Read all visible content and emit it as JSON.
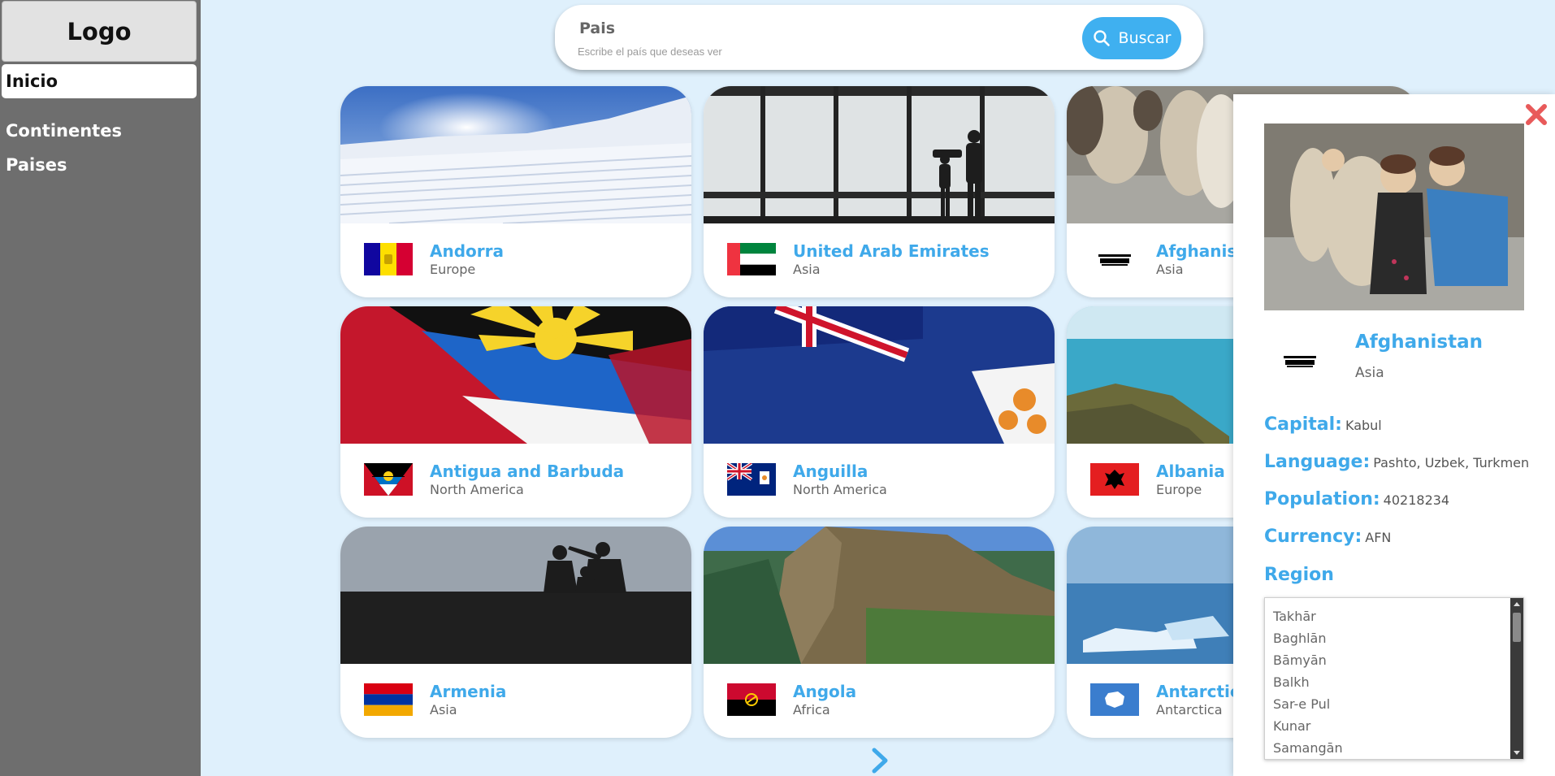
{
  "sidebar": {
    "logo": "Logo",
    "items": [
      {
        "label": "Inicio",
        "active": true
      },
      {
        "label": "Continentes",
        "active": false
      },
      {
        "label": "Paises",
        "active": false
      }
    ]
  },
  "search": {
    "label": "Pais",
    "placeholder": "Escribe el país que deseas ver",
    "button_label": "Buscar"
  },
  "cards": [
    {
      "name": "Andorra",
      "continent": "Europe"
    },
    {
      "name": "United Arab Emirates",
      "continent": "Asia"
    },
    {
      "name": "Afghanistan",
      "continent": "Asia"
    },
    {
      "name": "Antigua and Barbuda",
      "continent": "North America"
    },
    {
      "name": "Anguilla",
      "continent": "North America"
    },
    {
      "name": "Albania",
      "continent": "Europe"
    },
    {
      "name": "Armenia",
      "continent": "Asia"
    },
    {
      "name": "Angola",
      "continent": "Africa"
    },
    {
      "name": "Antarctica",
      "continent": "Antarctica"
    }
  ],
  "detail": {
    "name": "Afghanistan",
    "continent": "Asia",
    "capital_label": "Capital:",
    "capital": "Kabul",
    "language_label": "Language:",
    "language": "Pashto, Uzbek, Turkmen",
    "population_label": "Population:",
    "population": "40218234",
    "currency_label": "Currency:",
    "currency": "AFN",
    "region_label": "Region",
    "regions": [
      "Takhār",
      "Baghlān",
      "Bāmyān",
      "Balkh",
      "Sar-e Pul",
      "Kunar",
      "Samangān"
    ]
  },
  "colors": {
    "accent": "#3fa9ea",
    "sidebar": "#6e6e6e",
    "background": "#dff0fc",
    "close": "#e85a5a"
  },
  "icons": {
    "search": "search-icon",
    "close": "close-icon",
    "next": "chevron-right-icon"
  }
}
